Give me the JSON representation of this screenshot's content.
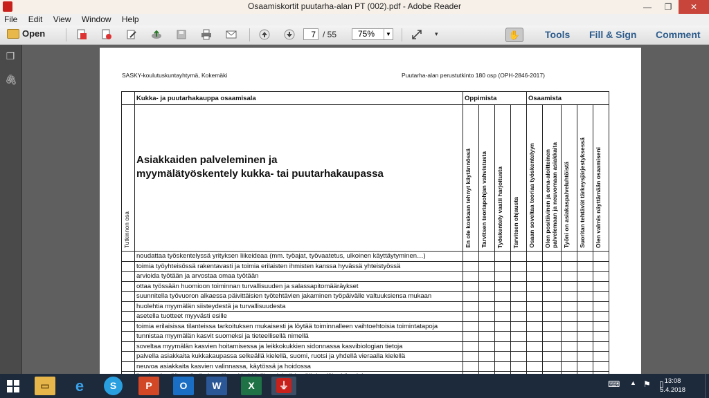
{
  "window": {
    "title": "Osaamiskortit puutarha-alan PT (002).pdf - Adobe Reader",
    "controls": {
      "minimize": "—",
      "restore": "❐",
      "close": "✕"
    }
  },
  "menu": [
    "File",
    "Edit",
    "View",
    "Window",
    "Help"
  ],
  "toolbar": {
    "open_label": "Open",
    "page_current": "7",
    "page_total": "/ 55",
    "zoom": "75%",
    "tools_label": "Tools",
    "fill_sign_label": "Fill & Sign",
    "comment_label": "Comment"
  },
  "document": {
    "header_left": "SASKY-koulutuskuntayhtymä, Kokemäki",
    "header_right": "Puutarha-alan perustutkinto 180 osp (OPH-2846-2017)",
    "section_title": "Kukka- ja puutarhakauppa osaamisala",
    "group_learner": "Oppimista",
    "group_competence": "Osaamista",
    "side_label": "Tutkinnon osa",
    "unit_title_line1": "Asiakkaiden palveleminen ja",
    "unit_title_line2": "myymälätyöskentely kukka- tai puutarhakaupassa",
    "rating_columns": [
      "En ole koskaan tehnyt käytännössä",
      "Tarvitsen teoriapohjan vahvistusta",
      "Työskentely vaatii harjoitusta",
      "Tarvitsen ohjausta",
      "Osaan soveltaa teoriaa työskentelyyn",
      "Olen positiivinen ja oma-aloitteinen palvelemaan ja neuvomaan asiakkaita",
      "Työni on asiakaspalveluhtöistä",
      "Suoritan tehtävät tärkeysjärjestyksessä",
      "Olen valmis näyttämään osaamiseni"
    ],
    "rows": [
      "noudattaa työskentelyssä yrityksen liikeideaa (mm. työajat, työvaatetus, ulkoinen käyttäytyminen…)",
      "toimia työyhteisössä rakentavasti ja toimia erilaisten ihmisten kanssa hyvässä yhteistyössä",
      "arvioida työtään ja arvostaa omaa työtään",
      "ottaa työssään huomioon toiminnan turvallisuuden ja salassapitomääräykset",
      "suunnitella työvuoron alkaessa päivittäisien työtehtävien jakaminen työpäivälle valtuuksiensa mukaan",
      "huolehtia myymälän siisteydestä ja turvallisuudesta",
      "asetella tuotteet myyvästi esille",
      "toimia erilaisissa tilanteissa tarkoituksen mukaisesti ja löytää toiminnalleen vaihtoehtoisia toimintatapoja",
      "tunnistaa myymälän kasvit suomeksi ja tieteellisellä nimellä",
      "soveltaa myymälän kasvien hoitamisessa ja leikkokukkien sidonnassa kasvibiologian tietoja",
      "palvella asiakkaita kukkakaupassa selkeällä kielellä, suomi, ruotsi ja yhdellä vieraalla kielellä",
      "neuvoa asiakkaita kasvien valinnassa, käytössä ja hoidossa",
      "ilmaista itseään selkeästi suullisesti ja kirjallisesti, hyödyntää tietolähteitä asiakasneuvonnassa"
    ]
  },
  "taskbar": {
    "apps": [
      "start",
      "file-explorer",
      "internet-explorer",
      "skype",
      "powerpoint",
      "outlook",
      "word",
      "excel",
      "adobe-reader"
    ],
    "time": "13:08",
    "date": "5.4.2018"
  }
}
